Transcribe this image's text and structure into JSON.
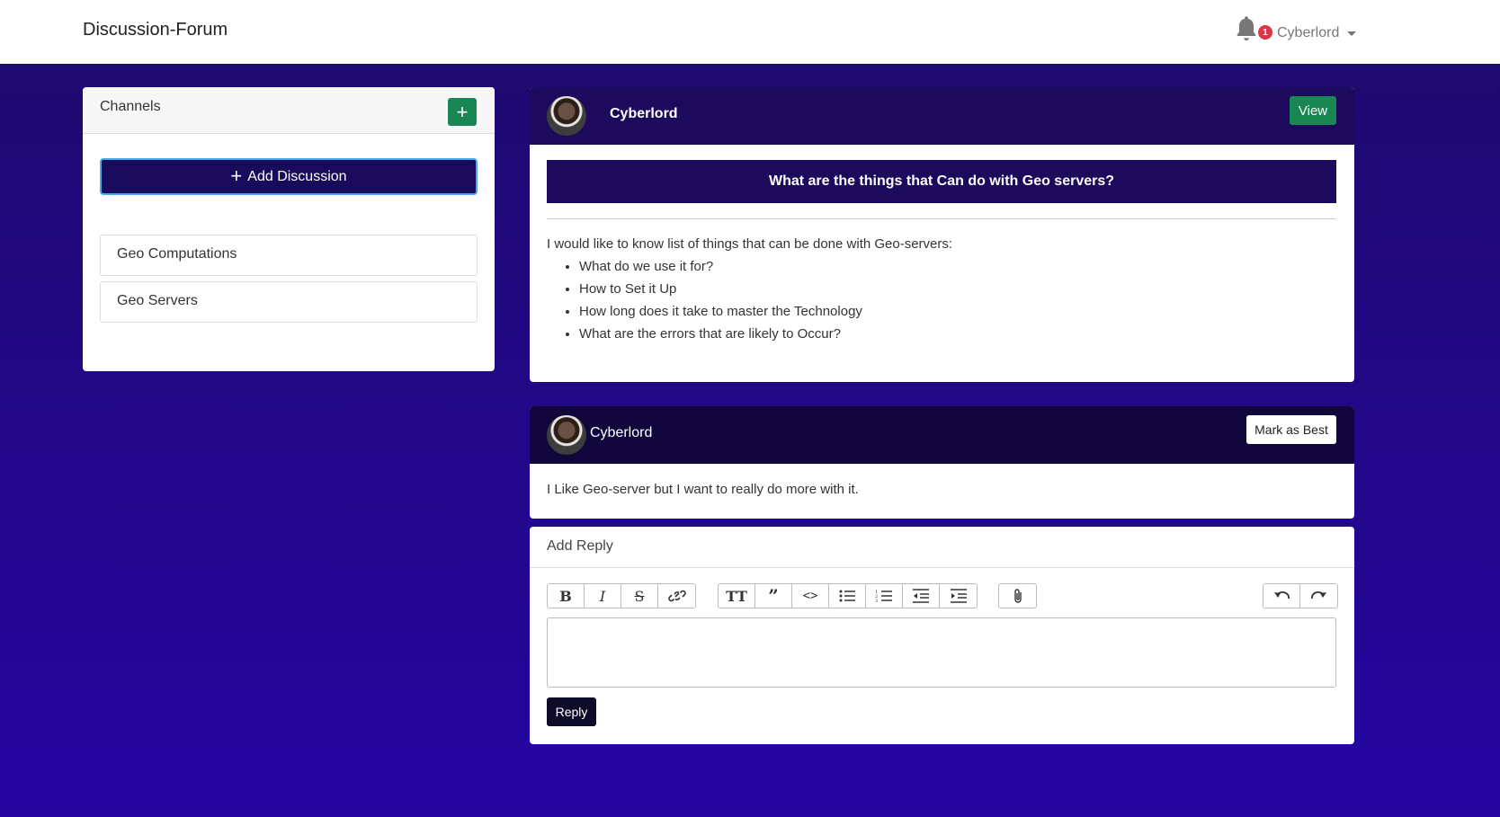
{
  "navbar": {
    "brand": "Discussion-Forum",
    "notification_count": "1",
    "user": "Cyberlord"
  },
  "channels": {
    "title": "Channels",
    "add_discussion": "Add Discussion",
    "items": [
      {
        "label": "Geo Computations"
      },
      {
        "label": "Geo Servers"
      }
    ]
  },
  "post": {
    "author": "Cyberlord",
    "view_label": "View",
    "title": "What are the things that Can do with Geo servers?",
    "intro": "I would like to know list of things that can be done with Geo-servers:",
    "bullets": [
      "What do we use it for?",
      "How to Set it Up",
      "How long does it take to master the Technology",
      "What are the errors that are likely to Occur?"
    ]
  },
  "reply": {
    "author": "Cyberlord",
    "mark_label": "Mark as Best",
    "text": "I Like Geo-server but I want to really do more with it."
  },
  "add_reply": {
    "title": "Add Reply",
    "reply_label": "Reply",
    "toolbar_icons": [
      "bold-icon",
      "italic-icon",
      "strikethrough-icon",
      "link-icon",
      "heading-icon",
      "quote-icon",
      "code-icon",
      "bullet-list-icon",
      "numbered-list-icon",
      "decrease-indent-icon",
      "increase-indent-icon",
      "attach-icon",
      "undo-icon",
      "redo-icon"
    ]
  },
  "colors": {
    "accent_green": "#198754",
    "header_purple": "#1e0a5c",
    "badge_red": "#dc3545"
  }
}
